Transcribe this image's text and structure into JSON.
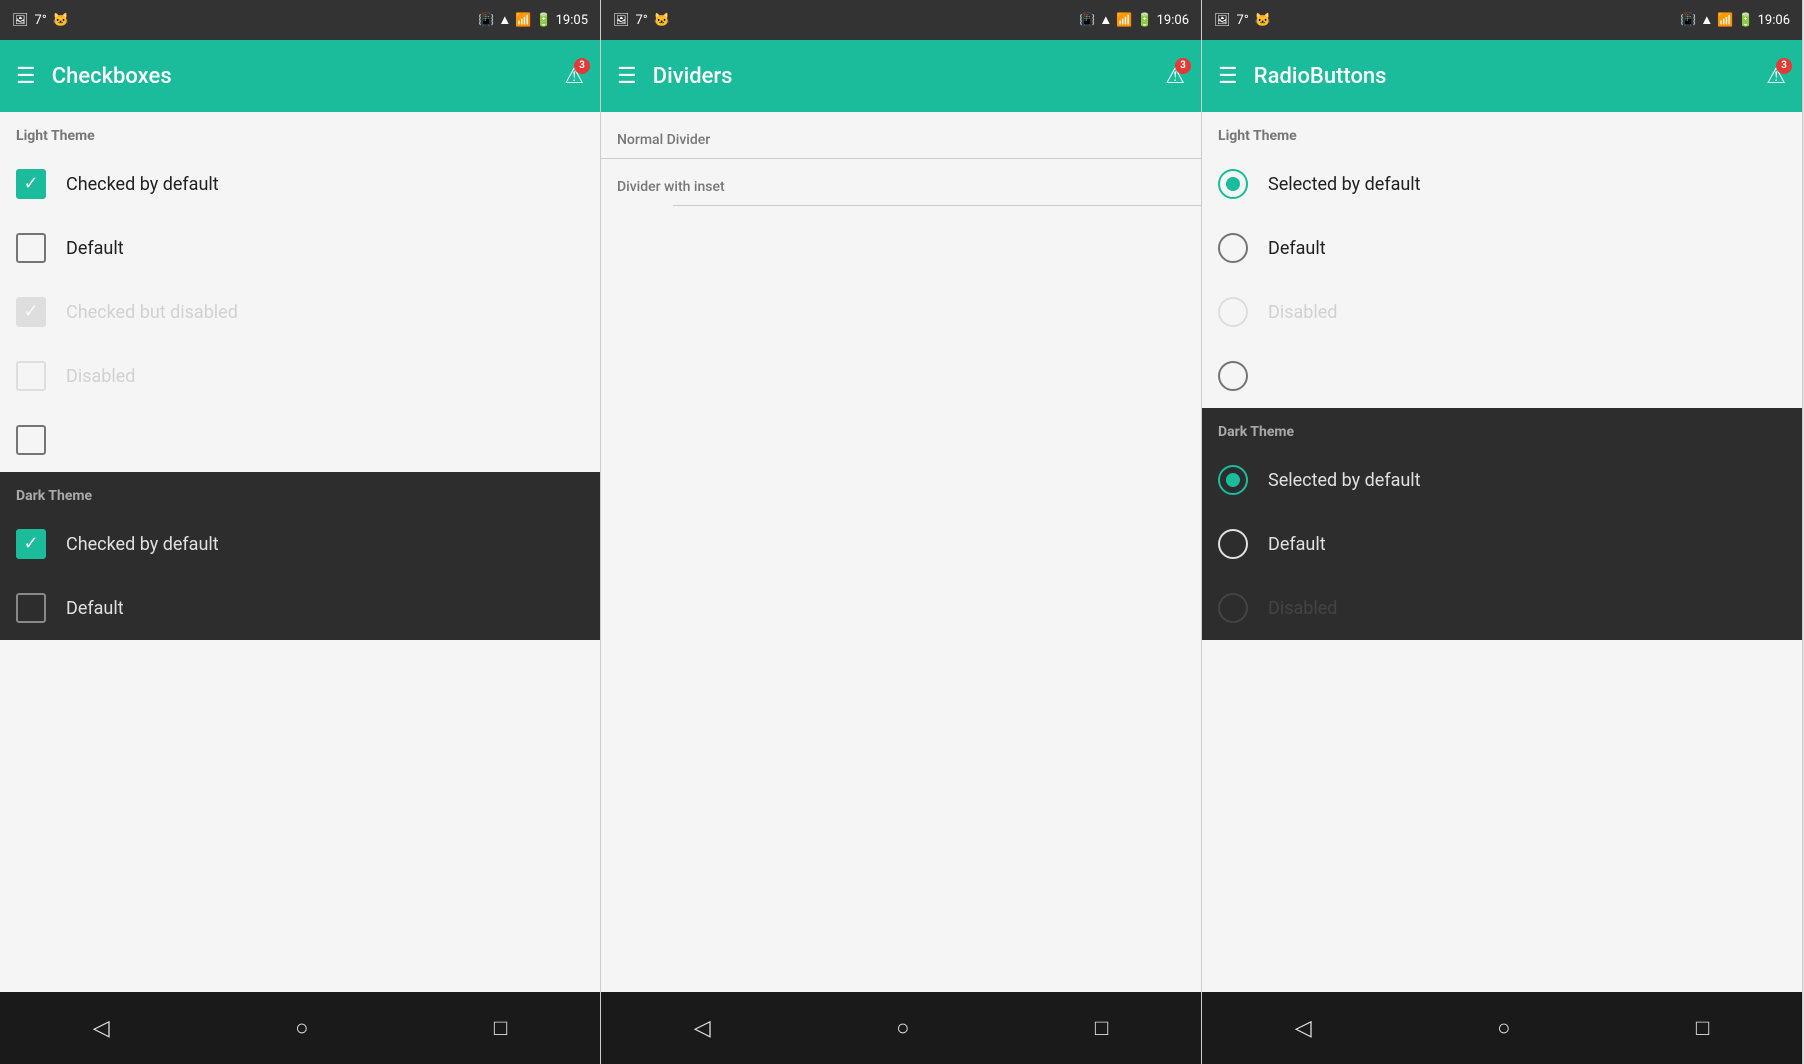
{
  "panels": [
    {
      "id": "checkboxes",
      "statusBar": {
        "left": [
          "7°",
          "🐱"
        ],
        "time": "19:05",
        "right": [
          "📳",
          "▲",
          "📶",
          "🔋"
        ]
      },
      "appBar": {
        "title": "Checkboxes",
        "badge": "3"
      },
      "lightThemeLabel": "Light Theme",
      "lightItems": [
        {
          "state": "checked",
          "label": "Checked by default",
          "disabled": false
        },
        {
          "state": "empty",
          "label": "Default",
          "disabled": false
        },
        {
          "state": "checked",
          "label": "Checked but disabled",
          "disabled": true
        },
        {
          "state": "empty",
          "label": "Disabled",
          "disabled": true
        },
        {
          "state": "empty",
          "label": "",
          "disabled": false
        }
      ],
      "darkThemeLabel": "Dark Theme",
      "darkItems": [
        {
          "state": "checked",
          "label": "Checked by default",
          "disabled": false
        },
        {
          "state": "empty",
          "label": "Default",
          "disabled": false
        }
      ],
      "nav": [
        "◁",
        "○",
        "□"
      ]
    },
    {
      "id": "dividers",
      "statusBar": {
        "left": [
          "7°",
          "🐱"
        ],
        "time": "19:06",
        "right": [
          "📳",
          "▲",
          "📶",
          "🔋"
        ]
      },
      "appBar": {
        "title": "Dividers",
        "badge": "3"
      },
      "normalDividerLabel": "Normal Divider",
      "insetDividerLabel": "Divider with inset",
      "nav": [
        "◁",
        "○",
        "□"
      ]
    },
    {
      "id": "radiobuttons",
      "statusBar": {
        "left": [
          "7°",
          "🐱"
        ],
        "time": "19:06",
        "right": [
          "📳",
          "▲",
          "📶",
          "🔋"
        ]
      },
      "appBar": {
        "title": "RadioButtons",
        "badge": "3"
      },
      "lightThemeLabel": "Light Theme",
      "lightItems": [
        {
          "state": "selected",
          "label": "Selected by default",
          "disabled": false
        },
        {
          "state": "default",
          "label": "Default",
          "disabled": false
        },
        {
          "state": "disabled",
          "label": "Disabled",
          "disabled": true
        },
        {
          "state": "default",
          "label": "",
          "disabled": false
        }
      ],
      "darkThemeLabel": "Dark Theme",
      "darkItems": [
        {
          "state": "selected",
          "label": "Selected by default",
          "disabled": false
        },
        {
          "state": "default",
          "label": "Default",
          "disabled": false
        },
        {
          "state": "disabled",
          "label": "Disabled",
          "disabled": true
        }
      ],
      "nav": [
        "◁",
        "○",
        "□"
      ]
    }
  ]
}
